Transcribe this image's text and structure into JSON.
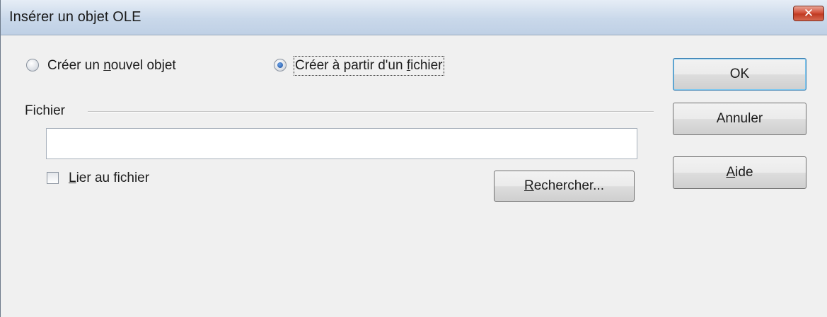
{
  "window": {
    "title": "Insérer un objet OLE",
    "close_symbol": "✕"
  },
  "options": {
    "create_new": {
      "label_pre": "Créer un ",
      "label_u": "n",
      "label_post": "ouvel objet",
      "selected": false
    },
    "create_from_file": {
      "label_pre": "Créer à partir d'un ",
      "label_u": "f",
      "label_post": "ichier",
      "selected": true
    }
  },
  "file_section": {
    "title": "Fichier",
    "path_value": "",
    "link_checkbox": {
      "label_u": "L",
      "label_post": "ier au fichier",
      "checked": false
    },
    "browse_button": {
      "label_u": "R",
      "label_post": "echercher..."
    }
  },
  "buttons": {
    "ok": "OK",
    "cancel": "Annuler",
    "help_u": "A",
    "help_post": "ide"
  }
}
